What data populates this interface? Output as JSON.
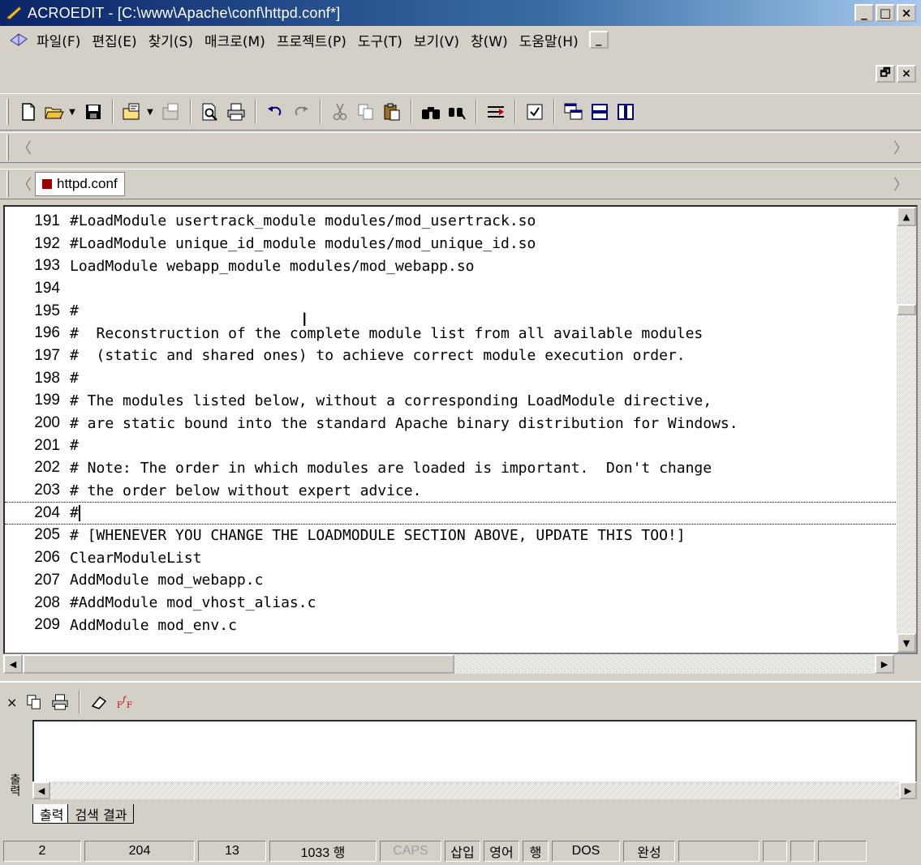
{
  "window": {
    "title": "ACROEDIT - [C:\\www\\Apache\\conf\\httpd.conf*]",
    "minimize_label": "_",
    "maximize_label": "□",
    "close_label": "×",
    "doc_restore_label": "🗗",
    "doc_close_label": "×"
  },
  "menu": {
    "items": [
      "파일(F)",
      "편집(E)",
      "찾기(S)",
      "매크로(M)",
      "프로젝트(P)",
      "도구(T)",
      "보기(V)",
      "창(W)",
      "도움말(H)"
    ]
  },
  "toolbar": {
    "buttons": [
      "new-file-icon",
      "open-folder-icon",
      "save-icon",
      "project-icon",
      "project-save-icon",
      "print-preview-icon",
      "print-icon",
      "undo-icon",
      "redo-icon",
      "cut-icon",
      "copy-icon",
      "paste-icon",
      "find-icon",
      "replace-icon",
      "goto-icon",
      "checklist-icon",
      "tile-windows-icon",
      "split-horizontal-icon",
      "split-vertical-icon"
    ]
  },
  "tabs": {
    "active_file": "httpd.conf"
  },
  "editor": {
    "lines": [
      {
        "n": "191",
        "text": "#LoadModule usertrack_module modules/mod_usertrack.so"
      },
      {
        "n": "192",
        "text": "#LoadModule unique_id_module modules/mod_unique_id.so"
      },
      {
        "n": "193",
        "text": "LoadModule webapp_module modules/mod_webapp.so"
      },
      {
        "n": "194",
        "text": ""
      },
      {
        "n": "195",
        "text": "#"
      },
      {
        "n": "196",
        "text": "#  Reconstruction of the complete module list from all available modules"
      },
      {
        "n": "197",
        "text": "#  (static and shared ones) to achieve correct module execution order."
      },
      {
        "n": "198",
        "text": "#"
      },
      {
        "n": "199",
        "text": "# The modules listed below, without a corresponding LoadModule directive,"
      },
      {
        "n": "200",
        "text": "# are static bound into the standard Apache binary distribution for Windows."
      },
      {
        "n": "201",
        "text": "#"
      },
      {
        "n": "202",
        "text": "# Note: The order in which modules are loaded is important.  Don't change"
      },
      {
        "n": "203",
        "text": "# the order below without expert advice."
      },
      {
        "n": "204",
        "text": "#"
      },
      {
        "n": "205",
        "text": "# [WHENEVER YOU CHANGE THE LOADMODULE SECTION ABOVE, UPDATE THIS TOO!]"
      },
      {
        "n": "206",
        "text": "ClearModuleList"
      },
      {
        "n": "207",
        "text": "AddModule mod_webapp.c"
      },
      {
        "n": "208",
        "text": "#AddModule mod_vhost_alias.c"
      },
      {
        "n": "209",
        "text": "AddModule mod_env.c"
      }
    ]
  },
  "output": {
    "side_label": "출력",
    "tabs": [
      "출력",
      "검색 결과"
    ]
  },
  "status": {
    "col": "2",
    "line": "204",
    "pos": "13",
    "total_lines": "1033 행",
    "caps": "CAPS",
    "insert": "삽입",
    "lang": "영어",
    "mode": "행",
    "eol": "DOS",
    "state": "완성"
  }
}
